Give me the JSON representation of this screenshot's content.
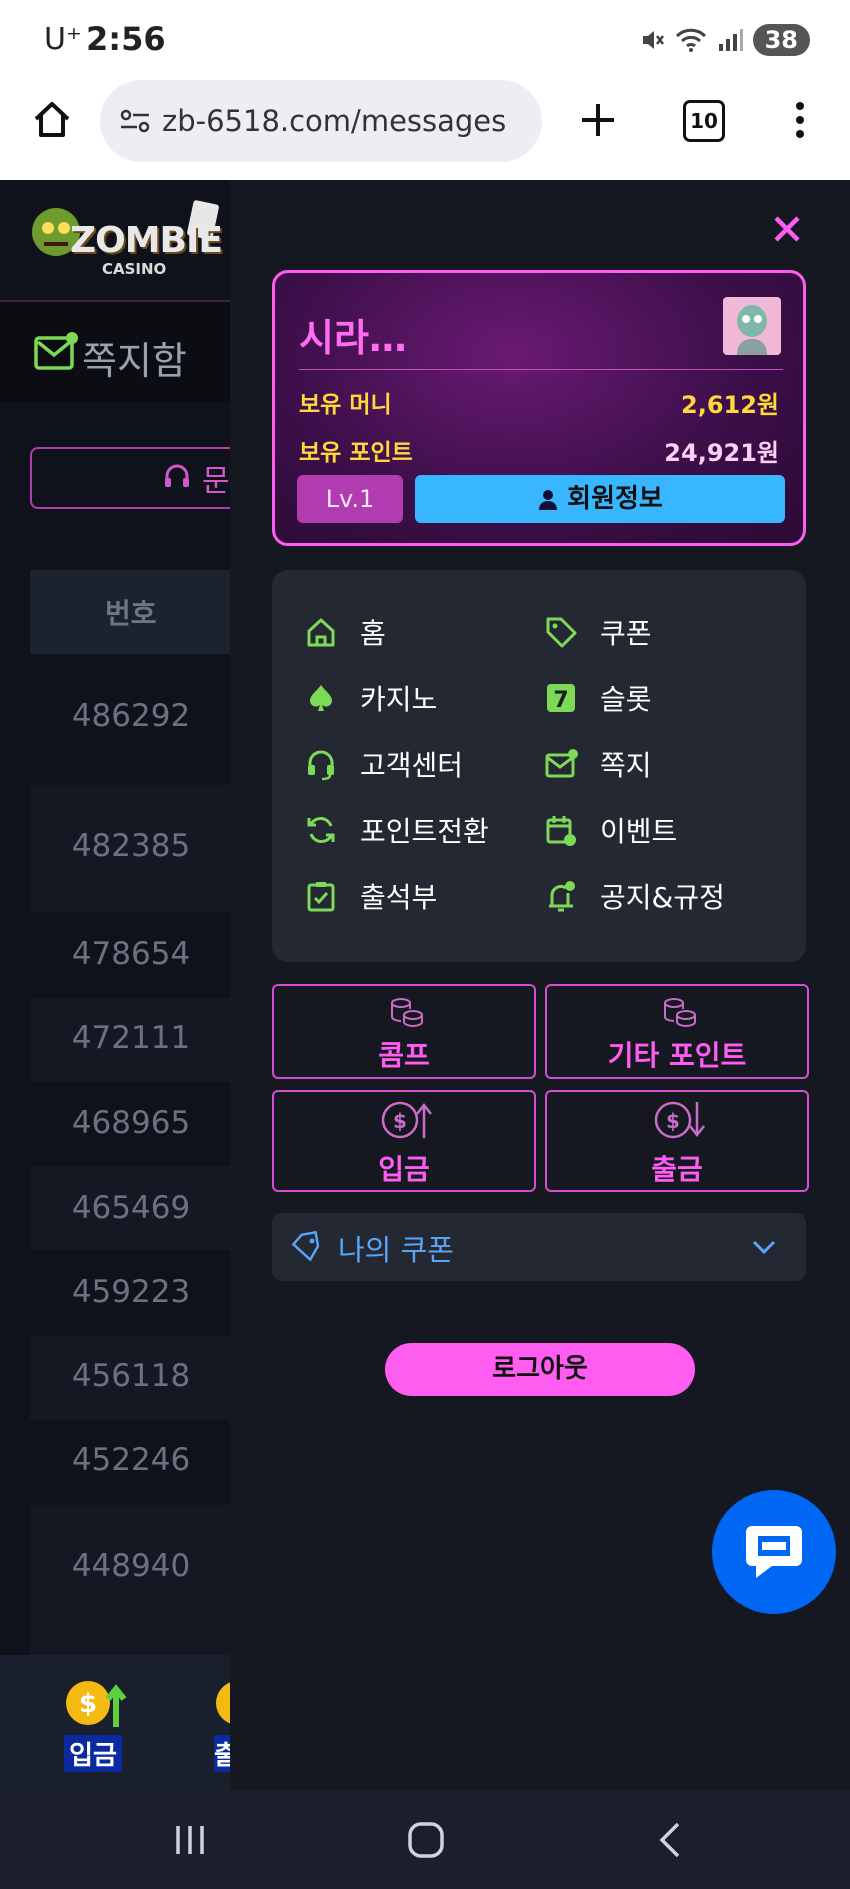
{
  "status_bar": {
    "carrier": "U⁺",
    "time": "2:56",
    "battery": "38"
  },
  "browser": {
    "url": "zb-6518.com/messages",
    "tab_count": "10"
  },
  "background_page": {
    "logo_text_1": "ZOMBIE",
    "logo_text_2": "CASINO",
    "section_title": "쪽지함",
    "button_partial": "문",
    "table_header": "번호",
    "rows": [
      "486292",
      "482385",
      "478654",
      "472111",
      "468965",
      "465469",
      "459223",
      "456118",
      "452246",
      "448940"
    ],
    "bottom_nav_label": "입금",
    "bottom_nav_partial": "출"
  },
  "drawer": {
    "profile": {
      "name": "시라…",
      "money_label": "보유 머니",
      "money_value": "2,612원",
      "points_label": "보유 포인트",
      "points_value": "24,921원",
      "level": "Lv.1",
      "member_info": "회원정보"
    },
    "menu": [
      {
        "label": "홈",
        "icon": "home-icon"
      },
      {
        "label": "쿠폰",
        "icon": "tag-icon"
      },
      {
        "label": "카지노",
        "icon": "spade-icon"
      },
      {
        "label": "슬롯",
        "icon": "seven-icon"
      },
      {
        "label": "고객센터",
        "icon": "headset-icon"
      },
      {
        "label": "쪽지",
        "icon": "mail-icon"
      },
      {
        "label": "포인트전환",
        "icon": "refresh-icon"
      },
      {
        "label": "이벤트",
        "icon": "calendar-icon"
      },
      {
        "label": "출석부",
        "icon": "checklist-icon"
      },
      {
        "label": "공지&규정",
        "icon": "bell-icon"
      }
    ],
    "point_buttons": {
      "comp": "콤프",
      "other_points": "기타 포인트",
      "deposit": "입금",
      "withdraw": "출금"
    },
    "coupon_dropdown": "나의 쿠폰",
    "logout": "로그아웃"
  },
  "colors": {
    "accent": "#ff5cf0",
    "member_info": "#38b6ff",
    "menu_icon": "#7ed957",
    "money": "#ffd93b"
  }
}
